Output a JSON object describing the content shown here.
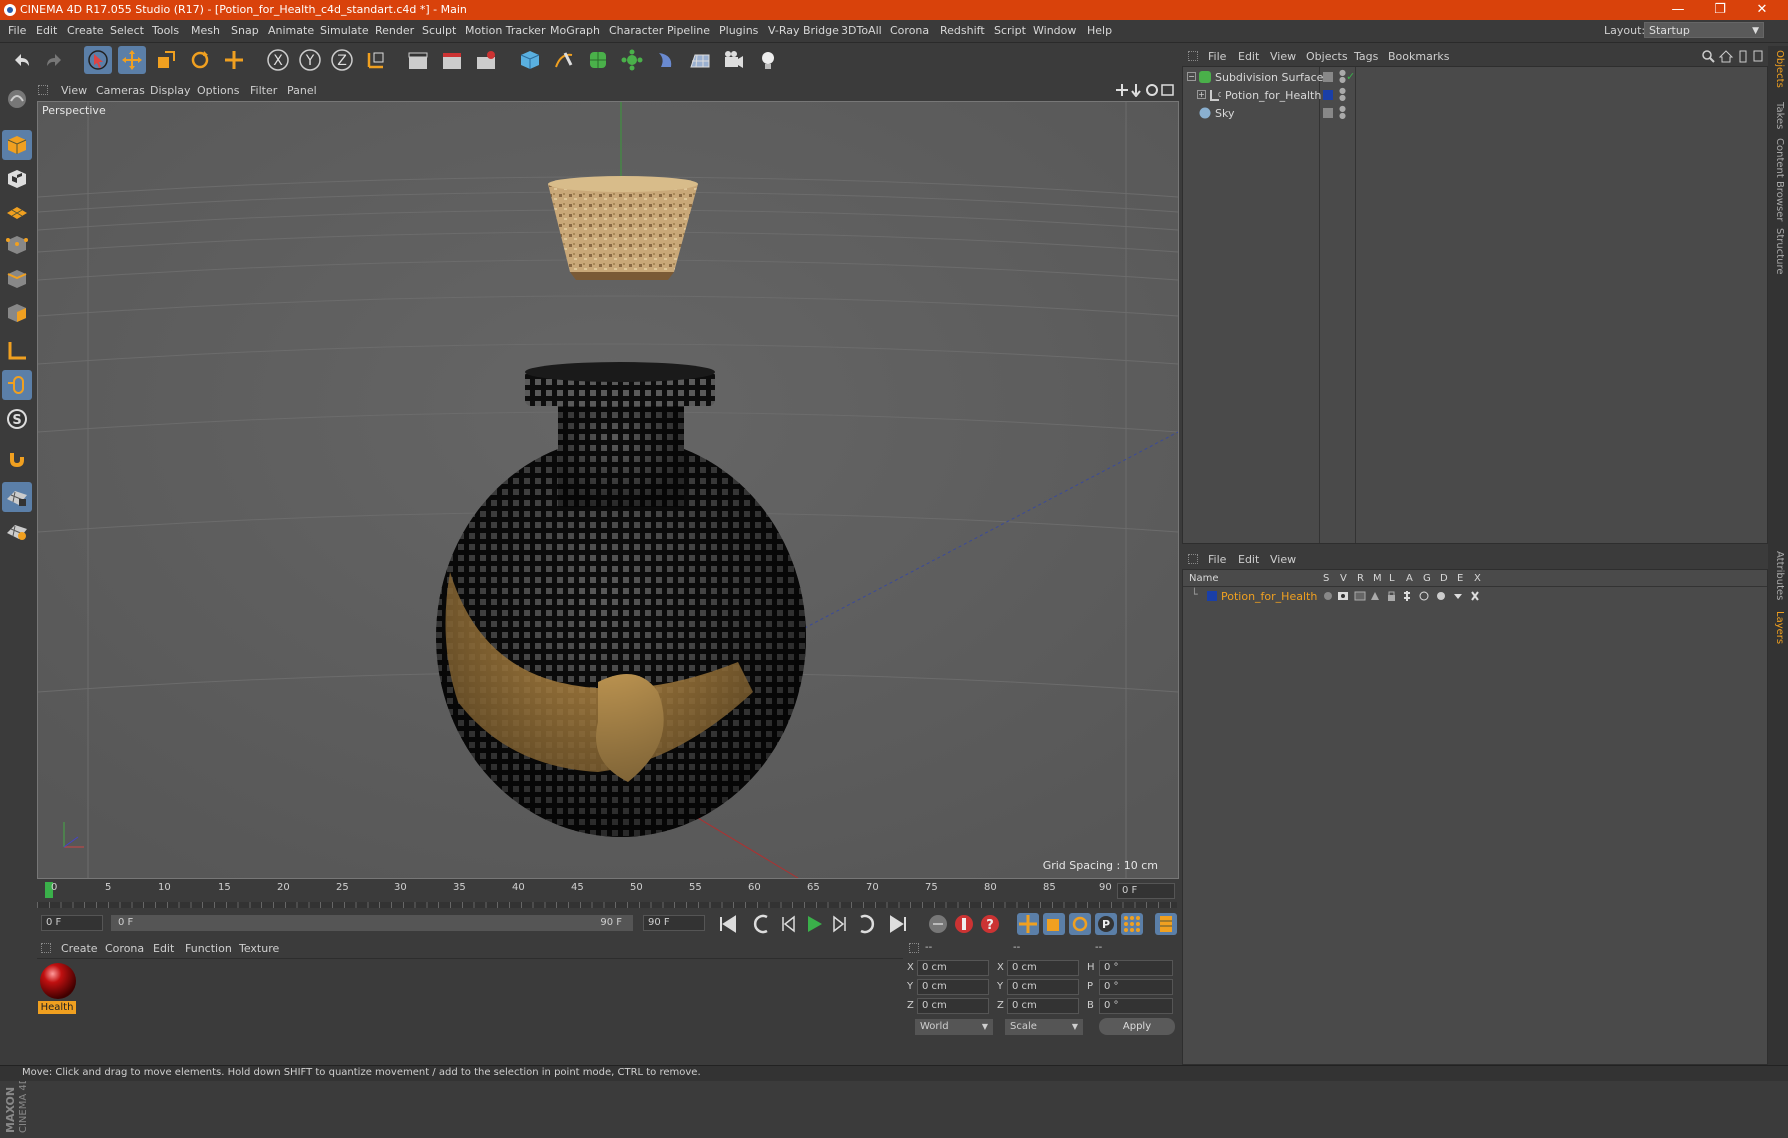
{
  "window": {
    "title": "CINEMA 4D R17.055 Studio (R17) - [Potion_for_Health_c4d_standart.c4d *] - Main",
    "min_glyph": "—",
    "max_glyph": "❐",
    "close_glyph": "✕"
  },
  "menubar": {
    "items": [
      "File",
      "Edit",
      "Create",
      "Select",
      "Tools",
      "Mesh",
      "Snap",
      "Animate",
      "Simulate",
      "Render",
      "Sculpt",
      "Motion Tracker",
      "MoGraph",
      "Character",
      "Pipeline",
      "Plugins",
      "V-Ray Bridge",
      "3DToAll",
      "Corona",
      "Redshift",
      "Script",
      "Window",
      "Help"
    ],
    "layout_label": "Layout:",
    "layout_value": "Startup"
  },
  "toolbar": {
    "axis_x": "X",
    "axis_y": "Y",
    "axis_z": "Z"
  },
  "viewport": {
    "menu": [
      "View",
      "Cameras",
      "Display",
      "Options",
      "Filter",
      "Panel"
    ],
    "label": "Perspective",
    "grid_spacing": "Grid Spacing : 10 cm"
  },
  "timeline": {
    "ticks": [
      "0",
      "5",
      "10",
      "15",
      "20",
      "25",
      "30",
      "35",
      "40",
      "45",
      "50",
      "55",
      "60",
      "65",
      "70",
      "75",
      "80",
      "85",
      "90"
    ],
    "current_frame": "0 F",
    "start_field": "0 F",
    "range_start": "0 F",
    "range_end": "90 F",
    "end_field": "90 F"
  },
  "materials": {
    "menu": [
      "Create",
      "Corona",
      "Edit",
      "Function",
      "Texture"
    ],
    "items": [
      {
        "name": "Health"
      }
    ]
  },
  "coordinates": {
    "head": [
      "--",
      "--",
      "--"
    ],
    "rows": [
      {
        "a": "X",
        "av": "0 cm",
        "b": "X",
        "bv": "0 cm",
        "c": "H",
        "cv": "0 °"
      },
      {
        "a": "Y",
        "av": "0 cm",
        "b": "Y",
        "bv": "0 cm",
        "c": "P",
        "cv": "0 °"
      },
      {
        "a": "Z",
        "av": "0 cm",
        "b": "Z",
        "bv": "0 cm",
        "c": "B",
        "cv": "0 °"
      }
    ],
    "world": "World",
    "scale": "Scale",
    "apply": "Apply"
  },
  "object_manager": {
    "menu": [
      "File",
      "Edit",
      "View",
      "Objects",
      "Tags",
      "Bookmarks"
    ],
    "objects": [
      {
        "name": "Subdivision Surface"
      },
      {
        "name": "Potion_for_Health"
      },
      {
        "name": "Sky"
      }
    ]
  },
  "layer_manager": {
    "menu": [
      "File",
      "Edit",
      "View"
    ],
    "name_header": "Name",
    "columns": [
      "S",
      "V",
      "R",
      "M",
      "L",
      "A",
      "G",
      "D",
      "E",
      "X"
    ],
    "layers": [
      {
        "name": "Potion_for_Health"
      }
    ]
  },
  "side_tabs": [
    "Objects",
    "Takes",
    "Content Browser",
    "Structure",
    "Attributes",
    "Layers"
  ],
  "status": "Move: Click and drag to move elements. Hold down SHIFT to quantize movement / add to the selection in point mode, CTRL to remove.",
  "colors": {
    "accent": "#d9420b",
    "selected": "#5b7fa8",
    "layer_text": "#f0a020"
  }
}
